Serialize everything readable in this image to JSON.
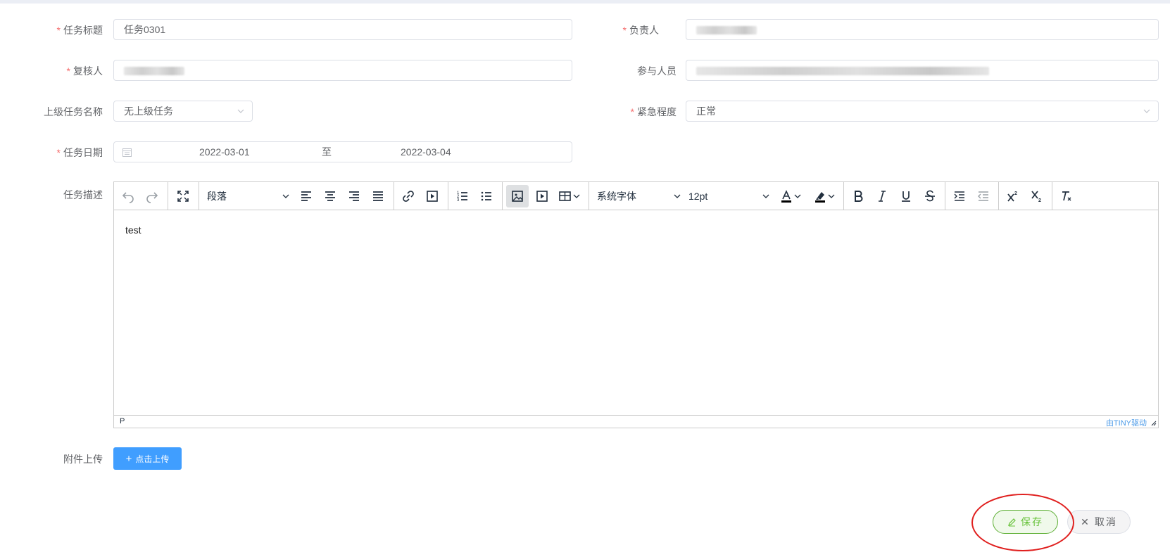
{
  "form": {
    "task_title": {
      "label": "任务标题",
      "value": "任务0301",
      "required": true
    },
    "owner": {
      "label": "负责人",
      "required": true
    },
    "reviewer": {
      "label": "复核人",
      "required": true
    },
    "participants": {
      "label": "参与人员",
      "required": false
    },
    "parent_task": {
      "label": "上级任务名称",
      "value": "无上级任务",
      "required": false
    },
    "urgency": {
      "label": "紧急程度",
      "value": "正常",
      "required": true
    },
    "task_date": {
      "label": "任务日期",
      "start": "2022-03-01",
      "separator": "至",
      "end": "2022-03-04",
      "required": true
    },
    "description": {
      "label": "任务描述"
    },
    "attachment": {
      "label": "附件上传",
      "button_label": "点击上传"
    }
  },
  "editor": {
    "block_format": "段落",
    "font_family": "系统字体",
    "font_size": "12pt",
    "content": "test",
    "status_path": "P",
    "branding": "由TINY驱动",
    "toolbar_icons": [
      "undo-icon",
      "redo-icon",
      "fullscreen-icon",
      "align-left-icon",
      "align-center-icon",
      "align-right-icon",
      "align-justify-icon",
      "link-icon",
      "media-icon",
      "numbered-list-icon",
      "bullet-list-icon",
      "image-icon",
      "media-embed-icon",
      "table-icon",
      "text-color-icon",
      "highlight-color-icon",
      "bold-icon",
      "italic-icon",
      "underline-icon",
      "strikethrough-icon",
      "indent-icon",
      "outdent-icon",
      "superscript-icon",
      "subscript-icon",
      "clear-format-icon"
    ]
  },
  "actions": {
    "save_label": "保存",
    "cancel_label": "取消"
  },
  "colors": {
    "required_star": "#f56c6c",
    "primary": "#409eff",
    "success": "#67c23a",
    "annotation": "#e0201f"
  }
}
